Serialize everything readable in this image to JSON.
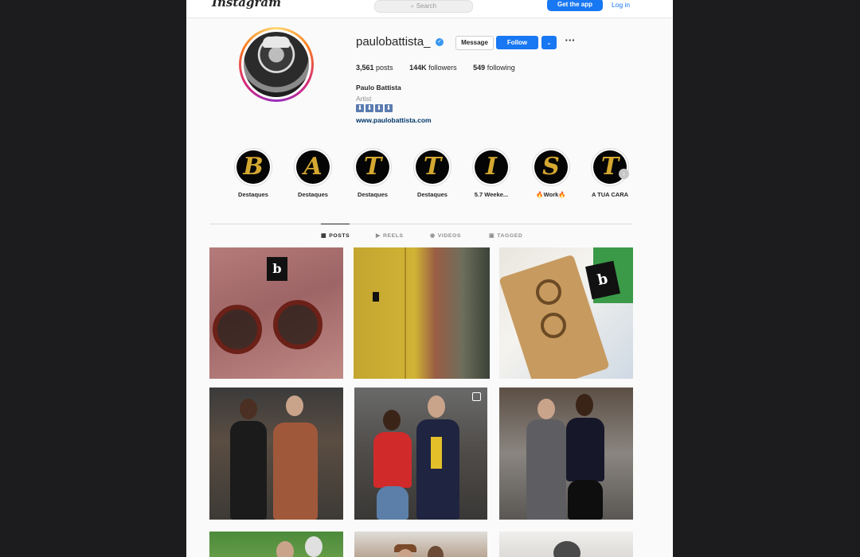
{
  "topbar": {
    "logo": "Instagram",
    "search_placeholder": "Search",
    "get_app": "Get the app",
    "login": "Log in"
  },
  "profile": {
    "username": "paulobattista_",
    "verified": true,
    "message_label": "Message",
    "follow_label": "Follow",
    "stats": {
      "posts": "3,561",
      "posts_label": "posts",
      "followers": "144K",
      "followers_label": "followers",
      "following": "549",
      "following_label": "following"
    },
    "full_name": "Paulo Battista",
    "category": "Artist",
    "bio_emojis": [
      "⬇",
      "⬇",
      "⬇",
      "⬇"
    ],
    "website": "www.paulobattista.com"
  },
  "highlights": [
    {
      "letter": "B",
      "label": "Destaques"
    },
    {
      "letter": "A",
      "label": "Destaques"
    },
    {
      "letter": "T",
      "label": "Destaques"
    },
    {
      "letter": "T",
      "label": "Destaques"
    },
    {
      "letter": "I",
      "label": "5.7 Weeke..."
    },
    {
      "letter": "S",
      "label": "🔥Work🔥"
    },
    {
      "letter": "T",
      "label": "A TUA CARA"
    }
  ],
  "tabs": [
    {
      "label": "POSTS",
      "icon": "grid-icon",
      "active": true
    },
    {
      "label": "REELS",
      "icon": "reels-icon",
      "active": false
    },
    {
      "label": "VIDEOS",
      "icon": "video-icon",
      "active": false
    },
    {
      "label": "TAGGED",
      "icon": "tag-icon",
      "active": false
    }
  ],
  "posts": [
    {
      "subject": "sunglasses on pink shirt"
    },
    {
      "subject": "corduroy jackets on rack"
    },
    {
      "subject": "tortoise glasses with case"
    },
    {
      "subject": "two men in atelier"
    },
    {
      "subject": "two men posing, red shirt"
    },
    {
      "subject": "two men in suits"
    },
    {
      "subject": "football pitch"
    },
    {
      "subject": "men in hats"
    },
    {
      "subject": "person portrait"
    }
  ],
  "colors": {
    "accent": "#1877f2",
    "highlight_gold": "#d4a830",
    "link": "#00376b"
  }
}
